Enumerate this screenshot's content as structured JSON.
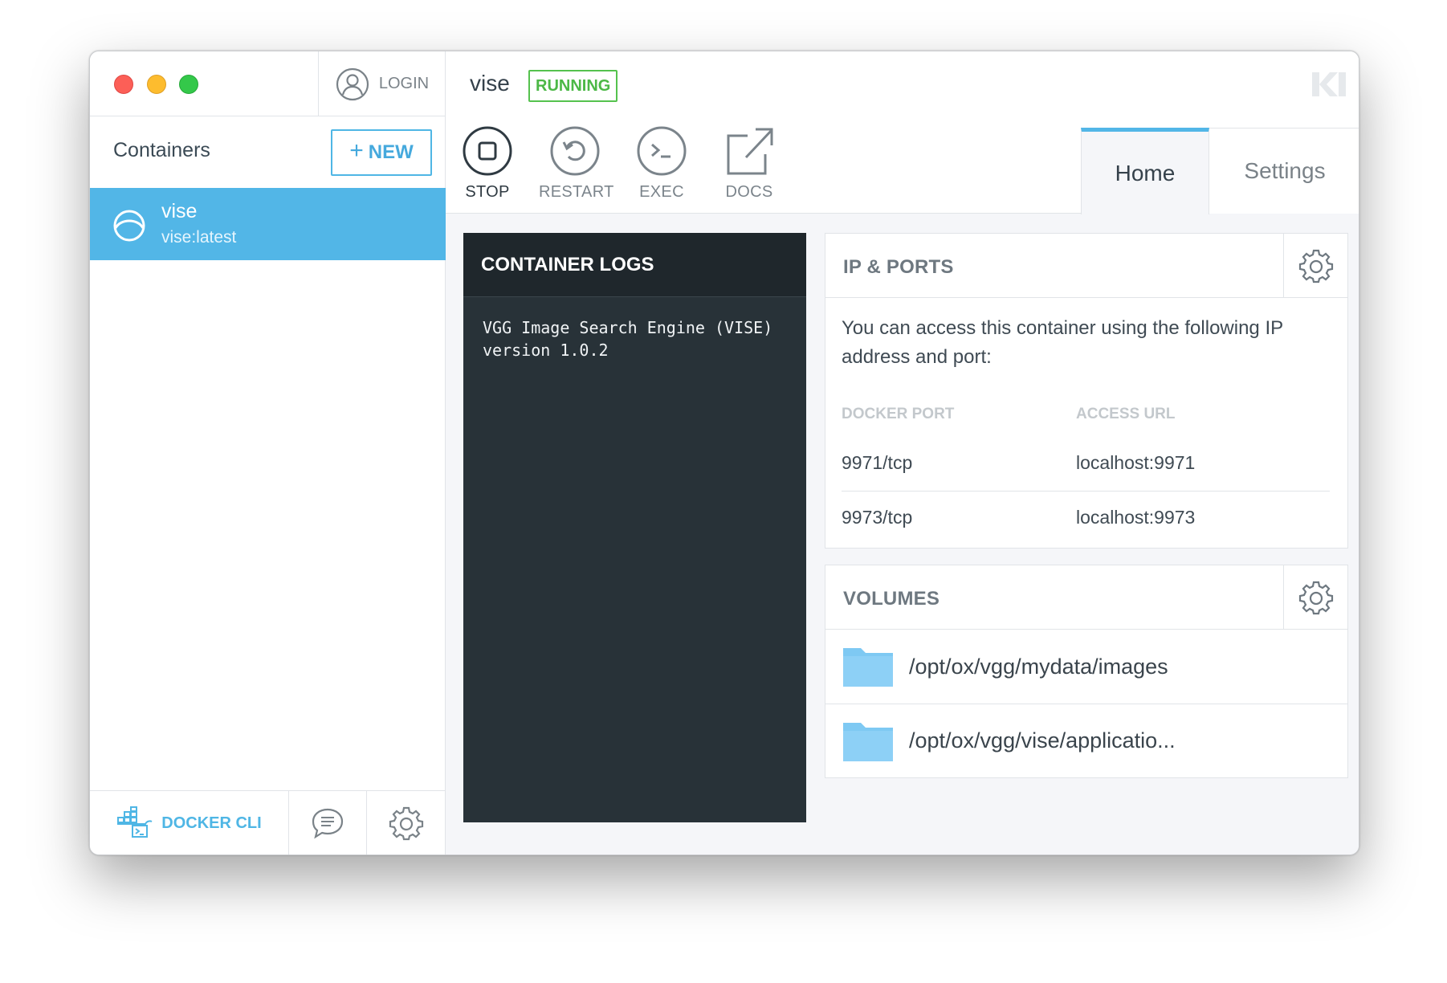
{
  "sidebar": {
    "login_label": "LOGIN",
    "title": "Containers",
    "new_button": {
      "icon": "plus-icon",
      "label": "NEW"
    },
    "containers": [
      {
        "name": "vise",
        "image": "vise:latest",
        "icon": "container-icon"
      }
    ],
    "footer": {
      "docker_cli_label": "DOCKER CLI",
      "feedback_icon": "chat-icon",
      "settings_icon": "gear-icon"
    }
  },
  "main": {
    "container_name": "vise",
    "status": "RUNNING",
    "actions": [
      {
        "label": "STOP",
        "icon": "stop-icon"
      },
      {
        "label": "RESTART",
        "icon": "restart-icon"
      },
      {
        "label": "EXEC",
        "icon": "terminal-icon"
      },
      {
        "label": "DOCS",
        "icon": "external-link-icon"
      }
    ],
    "tabs": [
      {
        "label": "Home",
        "active": true
      },
      {
        "label": "Settings",
        "active": false
      }
    ],
    "logs": {
      "title": "CONTAINER LOGS",
      "content": "VGG Image Search Engine (VISE)\nversion 1.0.2"
    },
    "ports": {
      "title": "IP & PORTS",
      "description": "You can access this container using the following IP address and port:",
      "headers": [
        "DOCKER PORT",
        "ACCESS URL"
      ],
      "rows": [
        [
          "9971/tcp",
          "localhost:9971"
        ],
        [
          "9973/tcp",
          "localhost:9973"
        ]
      ]
    },
    "volumes": {
      "title": "VOLUMES",
      "items": [
        "/opt/ox/vgg/mydata/images",
        "/opt/ox/vgg/vise/applicatio..."
      ]
    }
  },
  "colors": {
    "accent": "#52b6e7",
    "running": "#4cb846",
    "logs_bg": "#283238",
    "close": "#fc5f57",
    "minimize": "#fdbc2e",
    "zoom": "#34c84a"
  }
}
